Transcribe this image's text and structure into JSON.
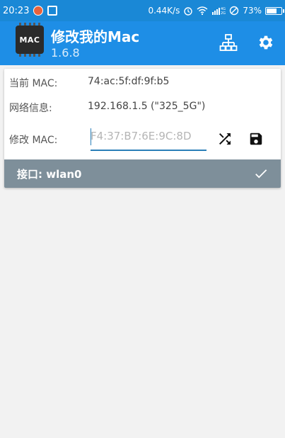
{
  "status_bar": {
    "time": "20:23",
    "net_speed": "0.44K/s",
    "battery_percent": "73%",
    "battery_level": 0.73
  },
  "app_bar": {
    "title": "修改我的Mac",
    "version": "1.6.8",
    "logo_text": "MAC",
    "actions": [
      "network-icon",
      "gear-icon"
    ]
  },
  "info": {
    "current_mac_label": "当前 MAC:",
    "current_mac_value": "74:ac:5f:df:9f:b5",
    "network_label": "网络信息:",
    "network_value": "192.168.1.5 (\"325_5G\")",
    "modify_mac_label": "修改 MAC:",
    "modify_mac_placeholder": "F4:37:B7:6E:9C:8D"
  },
  "interface_bar": {
    "label": "接口: wlan0"
  },
  "colors": {
    "status_bar": "#1a88d6",
    "app_bar": "#1e8ee6",
    "interface_bar": "#7e8f9a",
    "accent": "#2a7fb8"
  }
}
